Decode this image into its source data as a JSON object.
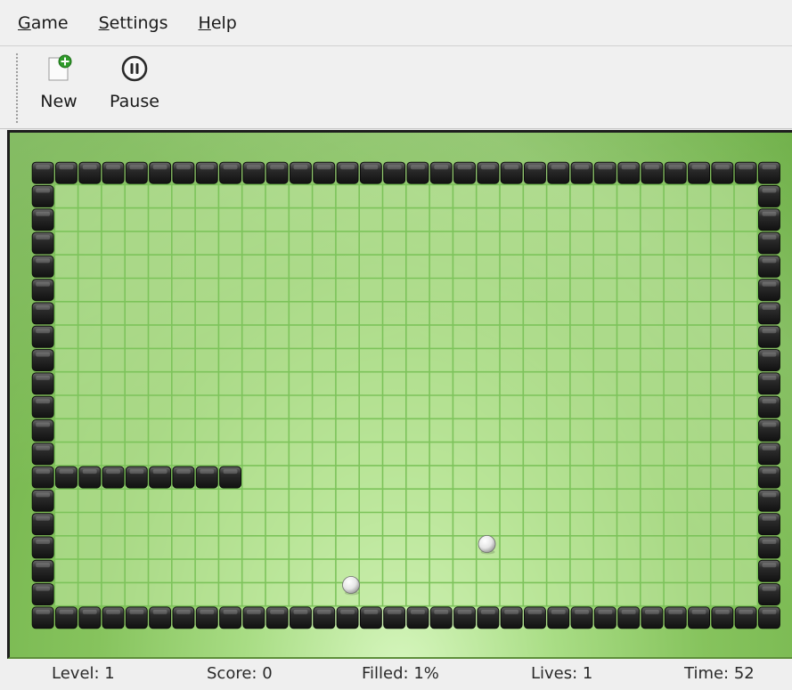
{
  "menu": {
    "items": [
      {
        "mnemonic": "G",
        "rest": "ame"
      },
      {
        "mnemonic": "S",
        "rest": "ettings"
      },
      {
        "mnemonic": "H",
        "rest": "elp"
      }
    ]
  },
  "toolbar": {
    "new_label": "New",
    "new_icon": "new-game-icon",
    "pause_label": "Pause",
    "pause_icon": "pause-icon"
  },
  "game": {
    "columns": 32,
    "rows": 20,
    "colors": {
      "wall": "#2b2b2b",
      "grid_line": "#7cc35a",
      "cell_fill": "#c7eba7",
      "ball": "#ffffff"
    },
    "wall_cells": [
      {
        "row": 13,
        "col_from": 1,
        "col_to": 8
      }
    ],
    "balls": [
      {
        "x_cells": 13.65,
        "y_cells": 18.1
      },
      {
        "x_cells": 19.45,
        "y_cells": 16.35
      }
    ]
  },
  "status": {
    "level": "Level: 1",
    "score": "Score: 0",
    "filled": "Filled: 1%",
    "lives": "Lives: 1",
    "time": "Time: 52"
  }
}
